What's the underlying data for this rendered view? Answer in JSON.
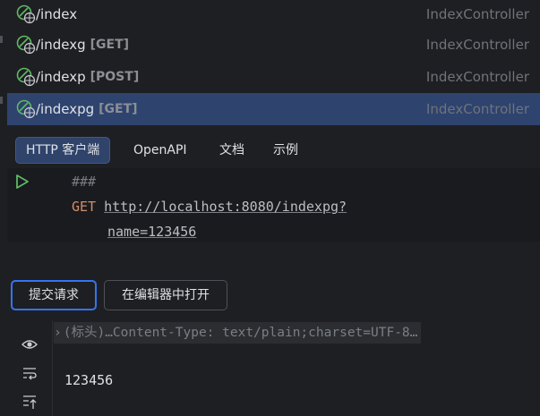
{
  "endpoints": [
    {
      "path": "/index",
      "method": "",
      "controller": "IndexController",
      "selected": false
    },
    {
      "path": "/indexg",
      "method": "[GET]",
      "controller": "IndexController",
      "selected": false
    },
    {
      "path": "/indexp",
      "method": "[POST]",
      "controller": "IndexController",
      "selected": false
    },
    {
      "path": "/indexpg",
      "method": "[GET]",
      "controller": "IndexController",
      "selected": true
    }
  ],
  "tabs": [
    {
      "label": "HTTP 客户端",
      "active": true
    },
    {
      "label": "OpenAPI",
      "active": false
    },
    {
      "label": "文档",
      "active": false
    },
    {
      "label": "示例",
      "active": false
    }
  ],
  "editor": {
    "comment": "###",
    "method": "GET",
    "url_line1": "http://localhost:8080/indexpg?",
    "url_line2": "name=123456"
  },
  "buttons": {
    "submit": "提交请求",
    "open_in_editor": "在编辑器中打开"
  },
  "response": {
    "headers_summary": "(标头)…Content-Type: text/plain;charset=UTF-8…",
    "body": "123456"
  },
  "colors": {
    "background": "#1e1f22",
    "selection": "#2e436e",
    "accent": "#3574f0",
    "keyword": "#cf8e6d",
    "run": "#5fb865"
  }
}
